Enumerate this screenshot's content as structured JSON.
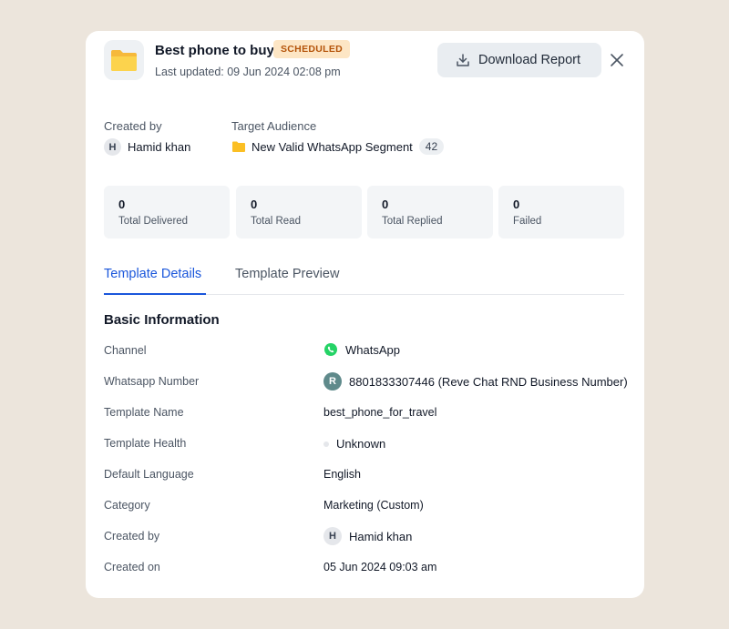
{
  "header": {
    "title": "Best phone to buy",
    "status_badge": "SCHEDULED",
    "last_updated": "Last updated: 09 Jun 2024 02:08 pm",
    "download_label": "Download Report"
  },
  "meta": {
    "created_by_label": "Created by",
    "created_by_initial": "H",
    "created_by_name": "Hamid khan",
    "target_label": "Target Audience",
    "segment_name": "New Valid WhatsApp Segment",
    "segment_count": "42"
  },
  "stats": [
    {
      "value": "0",
      "label": "Total Delivered"
    },
    {
      "value": "0",
      "label": "Total Read"
    },
    {
      "value": "0",
      "label": "Total Replied"
    },
    {
      "value": "0",
      "label": "Failed"
    }
  ],
  "tabs": [
    {
      "label": "Template Details",
      "active": true
    },
    {
      "label": "Template Preview",
      "active": false
    }
  ],
  "basic_info": {
    "title": "Basic Information",
    "rows": [
      {
        "label": "Channel",
        "value": "WhatsApp"
      },
      {
        "label": "Whatsapp Number",
        "value": "8801833307446 (Reve Chat RND Business Number)",
        "avatar": "R"
      },
      {
        "label": "Template Name",
        "value": "best_phone_for_travel"
      },
      {
        "label": "Template Health",
        "value": "Unknown"
      },
      {
        "label": "Default Language",
        "value": "English"
      },
      {
        "label": "Category",
        "value": "Marketing (Custom)"
      },
      {
        "label": "Created by",
        "value": "Hamid khan",
        "avatar": "H"
      },
      {
        "label": "Created on",
        "value": "05 Jun 2024 09:03 am"
      }
    ]
  },
  "colors": {
    "accent": "#1a56db",
    "badge_bg": "#fde6c5",
    "badge_text": "#b45309",
    "whatsapp": "#25d366",
    "folder": "#fbbf24"
  }
}
